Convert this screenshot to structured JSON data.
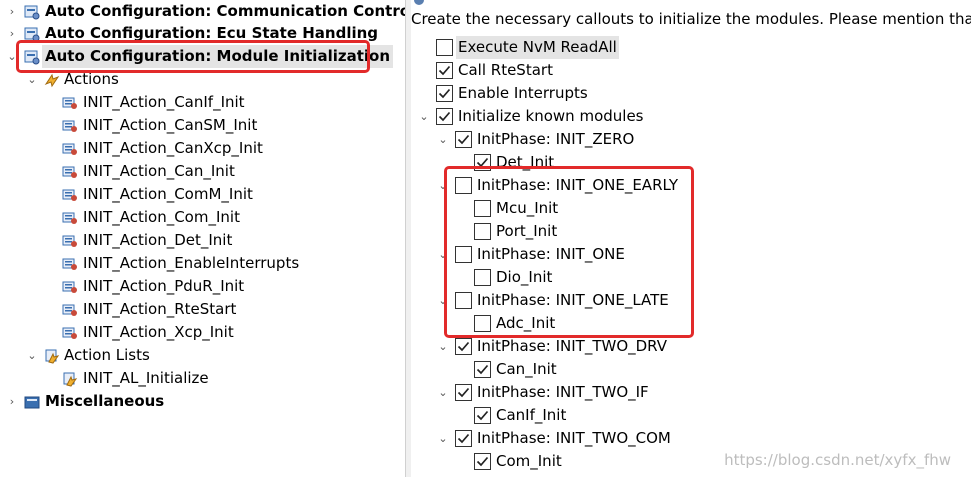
{
  "left_tree": {
    "items": [
      {
        "label": "Auto Configuration: Communication Control",
        "bold": true,
        "expanded": false
      },
      {
        "label": "Auto Configuration: Ecu State Handling",
        "bold": true,
        "expanded": false
      },
      {
        "label": "Auto Configuration: Module Initialization",
        "bold": true,
        "expanded": true,
        "selected": true
      },
      {
        "label": "Actions",
        "bold": false,
        "expanded": true
      },
      {
        "label": "INIT_Action_CanIf_Init"
      },
      {
        "label": "INIT_Action_CanSM_Init"
      },
      {
        "label": "INIT_Action_CanXcp_Init"
      },
      {
        "label": "INIT_Action_Can_Init"
      },
      {
        "label": "INIT_Action_ComM_Init"
      },
      {
        "label": "INIT_Action_Com_Init"
      },
      {
        "label": "INIT_Action_Det_Init"
      },
      {
        "label": "INIT_Action_EnableInterrupts"
      },
      {
        "label": "INIT_Action_PduR_Init"
      },
      {
        "label": "INIT_Action_RteStart"
      },
      {
        "label": "INIT_Action_Xcp_Init"
      },
      {
        "label": "Action Lists",
        "expanded": true
      },
      {
        "label": "INIT_AL_Initialize"
      },
      {
        "label": "Miscellaneous",
        "bold": true,
        "expanded": false
      }
    ]
  },
  "right_panel": {
    "description": "Create the necessary callouts to initialize the modules. Please mention that M",
    "items": [
      {
        "label": "Execute NvM ReadAll",
        "checked": false,
        "selected": true
      },
      {
        "label": "Call RteStart",
        "checked": true
      },
      {
        "label": "Enable Interrupts",
        "checked": true
      },
      {
        "label": "Initialize known modules",
        "checked": true
      },
      {
        "label": "InitPhase: INIT_ZERO",
        "checked": true
      },
      {
        "label": "Det_Init",
        "checked": true
      },
      {
        "label": "InitPhase: INIT_ONE_EARLY",
        "checked": false
      },
      {
        "label": "Mcu_Init",
        "checked": false
      },
      {
        "label": "Port_Init",
        "checked": false
      },
      {
        "label": "InitPhase: INIT_ONE",
        "checked": false
      },
      {
        "label": "Dio_Init",
        "checked": false
      },
      {
        "label": "InitPhase: INIT_ONE_LATE",
        "checked": false
      },
      {
        "label": "Adc_Init",
        "checked": false
      },
      {
        "label": "InitPhase: INIT_TWO_DRV",
        "checked": true
      },
      {
        "label": "Can_Init",
        "checked": true
      },
      {
        "label": "InitPhase: INIT_TWO_IF",
        "checked": true
      },
      {
        "label": "CanIf_Init",
        "checked": true
      },
      {
        "label": "InitPhase: INIT_TWO_COM",
        "checked": true
      },
      {
        "label": "Com_Init",
        "checked": true
      }
    ]
  },
  "watermark": "https://blog.csdn.net/xyfx_fhw",
  "colors": {
    "highlight_box": "#e22a2a",
    "selection": "#e4e4e4"
  }
}
